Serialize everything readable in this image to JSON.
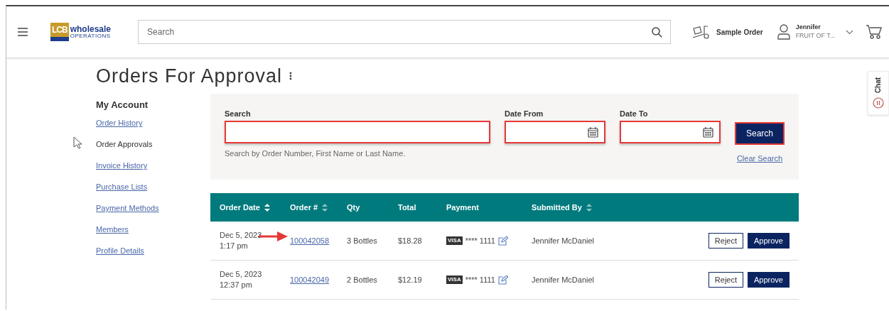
{
  "header": {
    "logo": {
      "badge": "LCB",
      "name": "wholesale",
      "sub": "OPERATIONS"
    },
    "search": {
      "placeholder": "Search"
    },
    "sample_order": "Sample Order",
    "user": {
      "name": "Jennifer",
      "org": "FRUIT OF T..."
    }
  },
  "page_title": "Orders For Approval",
  "sidebar": {
    "title": "My Account",
    "items": [
      {
        "label": "Order History",
        "selected": false
      },
      {
        "label": "Order Approvals",
        "selected": true
      },
      {
        "label": "Invoice History",
        "selected": false
      },
      {
        "label": "Purchase Lists",
        "selected": false
      },
      {
        "label": "Payment Methods",
        "selected": false
      },
      {
        "label": "Members",
        "selected": false
      },
      {
        "label": "Profile Details",
        "selected": false
      }
    ]
  },
  "filters": {
    "fields": [
      {
        "kind": "text",
        "label": "Search",
        "highlighted": true,
        "hint": "Search by Order Number, First Name or Last Name."
      },
      {
        "kind": "date",
        "label": "Date From",
        "highlighted": true
      },
      {
        "kind": "date",
        "label": "Date To",
        "highlighted": true
      }
    ],
    "search_button": {
      "label": "Search",
      "highlighted": true
    },
    "clear_link": "Clear Search"
  },
  "table": {
    "columns": [
      {
        "label": "Order Date",
        "sorted": true
      },
      {
        "label": "Order #",
        "sorted": false
      },
      {
        "label": "Qty"
      },
      {
        "label": "Total"
      },
      {
        "label": "Payment"
      },
      {
        "label": "Submitted By",
        "sorted": false
      }
    ],
    "rows": [
      {
        "date": "Dec 5, 2023",
        "time": "1:17 pm",
        "order": "100042058",
        "marked": true,
        "qty": "3 Bottles",
        "total": "$18.28",
        "card_brand": "VISA",
        "card": "**** 1111",
        "submitted_by": "Jennifer McDaniel",
        "reject": "Reject",
        "approve": "Approve"
      },
      {
        "date": "Dec 5, 2023",
        "time": "12:37 pm",
        "order": "100042049",
        "marked": false,
        "qty": "2 Bottles",
        "total": "$12.19",
        "card_brand": "VISA",
        "card": "**** 1111",
        "submitted_by": "Jennifer McDaniel",
        "reject": "Reject",
        "approve": "Approve"
      }
    ]
  },
  "chat_tab": "Chat"
}
